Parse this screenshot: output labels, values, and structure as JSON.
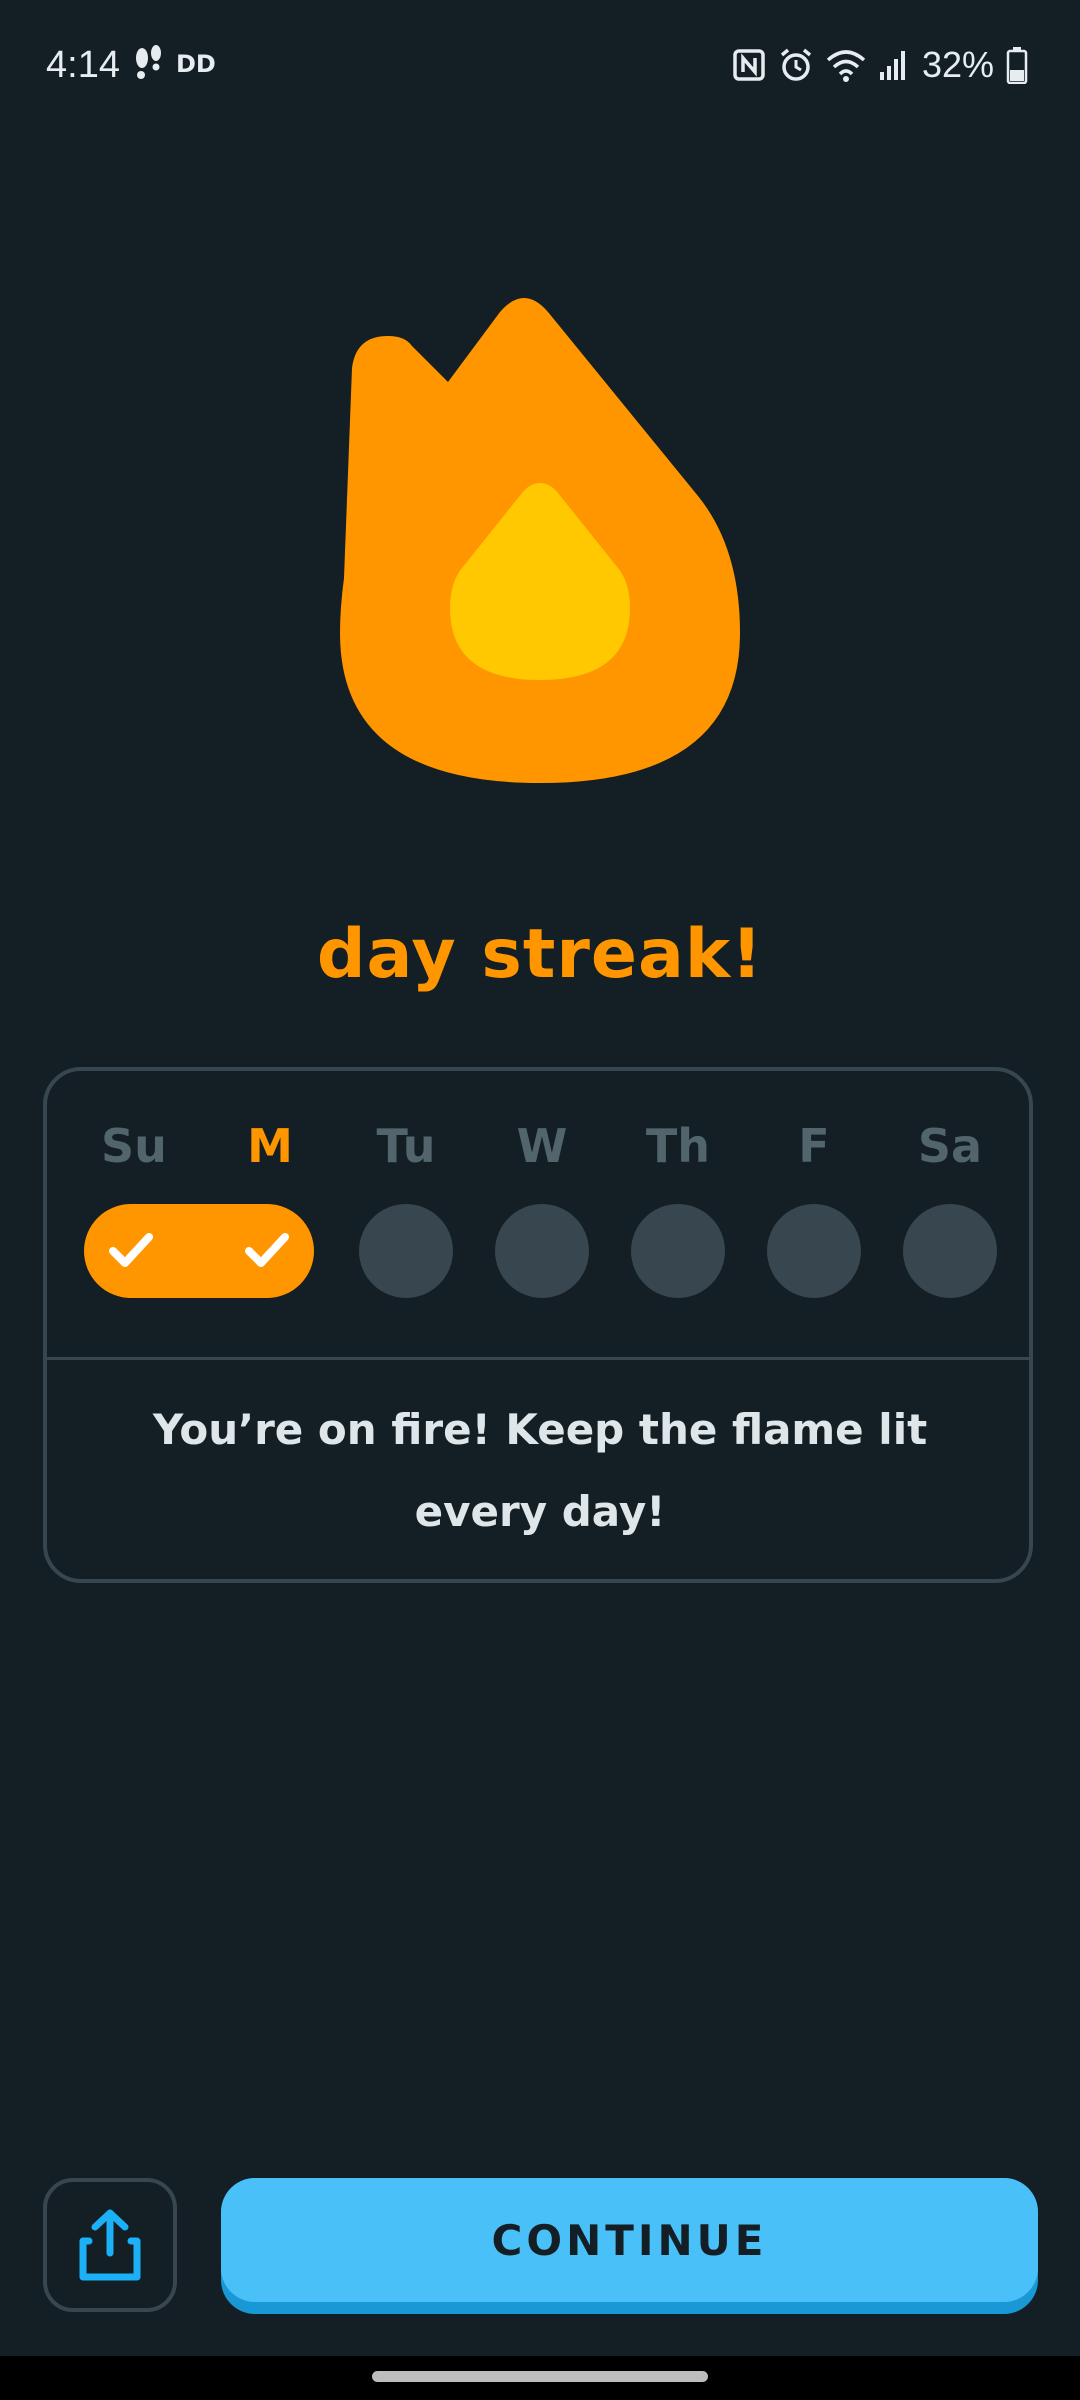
{
  "status_bar": {
    "time": "4:14",
    "battery": "32%",
    "icons": [
      "footprints-icon",
      "dd-badge-icon",
      "nfc-icon",
      "alarm-icon",
      "wifi-icon",
      "signal-icon",
      "battery-icon"
    ],
    "dd_text": "DD"
  },
  "streak": {
    "title": "day streak!",
    "flame_icon": "flame-icon",
    "accent_color": "#ff9600"
  },
  "week": {
    "days": [
      {
        "label": "Su",
        "completed": true,
        "today": false
      },
      {
        "label": "M",
        "completed": true,
        "today": true
      },
      {
        "label": "Tu",
        "completed": false,
        "today": false
      },
      {
        "label": "W",
        "completed": false,
        "today": false
      },
      {
        "label": "Th",
        "completed": false,
        "today": false
      },
      {
        "label": "F",
        "completed": false,
        "today": false
      },
      {
        "label": "Sa",
        "completed": false,
        "today": false
      }
    ],
    "message": "You’re on fire! Keep the flame lit every day!"
  },
  "actions": {
    "share_icon": "share-icon",
    "continue_label": "CONTINUE",
    "continue_color": "#49c0f8"
  }
}
